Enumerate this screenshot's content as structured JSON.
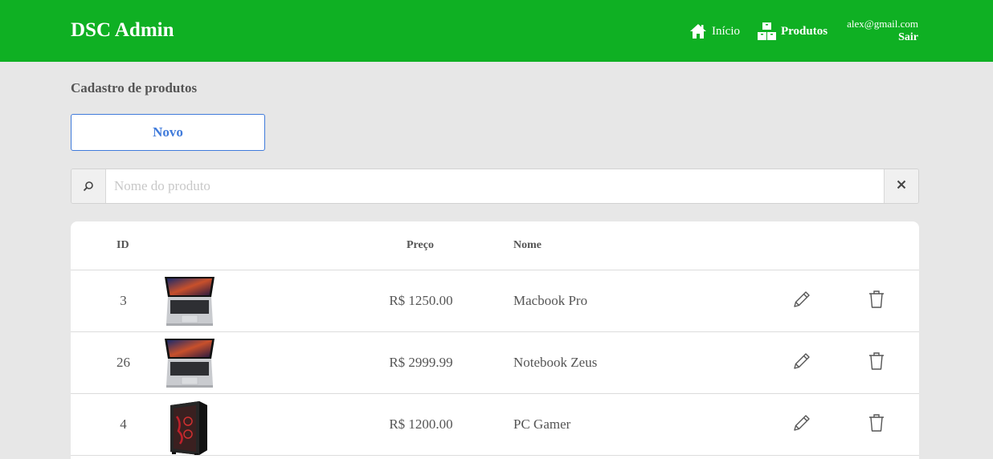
{
  "navbar": {
    "brand": "DSC Admin",
    "links": [
      {
        "label": "Início",
        "icon": "home-icon"
      },
      {
        "label": "Produtos",
        "icon": "boxes-icon"
      }
    ],
    "user_email": "alex@gmail.com",
    "logout_label": "Sair",
    "bg_color": "#0fb023"
  },
  "page": {
    "title": "Cadastro de produtos",
    "new_button_label": "Novo",
    "accent_color": "#407bdb"
  },
  "search": {
    "placeholder": "Nome do produto",
    "value": ""
  },
  "table": {
    "headers": {
      "id": "ID",
      "price": "Preço",
      "name": "Nome"
    },
    "rows": [
      {
        "id": "3",
        "price": "R$ 1250.00",
        "name": "Macbook Pro",
        "image": "laptop"
      },
      {
        "id": "26",
        "price": "R$ 2999.99",
        "name": "Notebook Zeus",
        "image": "laptop"
      },
      {
        "id": "4",
        "price": "R$ 1200.00",
        "name": "PC Gamer",
        "image": "pc-tower"
      }
    ]
  }
}
